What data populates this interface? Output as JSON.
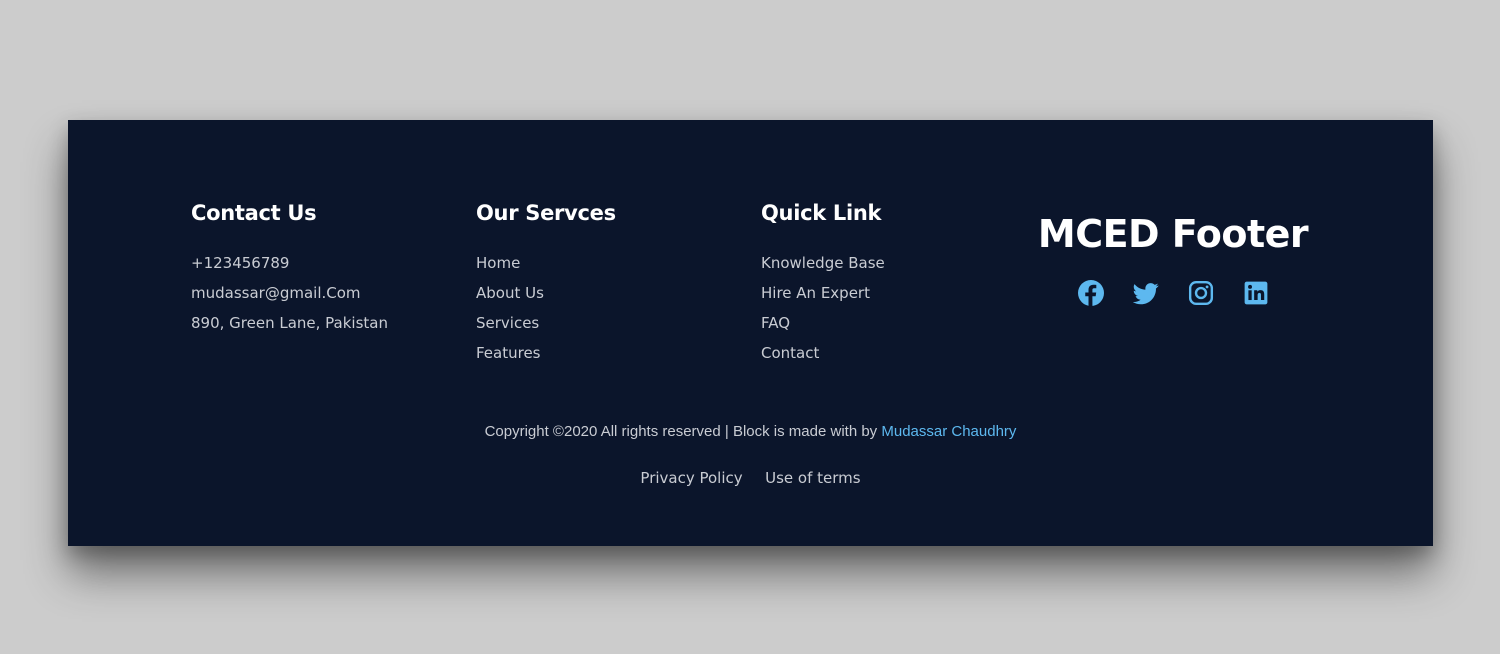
{
  "contact": {
    "heading": "Contact Us",
    "items": [
      "+123456789",
      "mudassar@gmail.Com",
      "890, Green Lane, Pakistan"
    ]
  },
  "services": {
    "heading": "Our Servces",
    "items": [
      "Home",
      "About Us",
      "Services",
      "Features"
    ]
  },
  "quick_links": {
    "heading": "Quick Link",
    "items": [
      "Knowledge Base",
      "Hire An Expert",
      "FAQ",
      "Contact"
    ]
  },
  "brand": {
    "title": "MCED Footer",
    "socials": [
      "facebook-icon",
      "twitter-icon",
      "instagram-icon",
      "linkedin-icon"
    ]
  },
  "copyright": {
    "text": "Copyright ©2020 All rights reserved | Block is made with by ",
    "author": "Mudassar Chaudhry"
  },
  "bottom_links": {
    "privacy": "Privacy Policy",
    "terms": "Use of terms"
  },
  "colors": {
    "background": "#cccccc",
    "footer_bg": "#0b152b",
    "text": "#c9ccd3",
    "heading": "#ffffff",
    "accent": "#5db8ef"
  }
}
